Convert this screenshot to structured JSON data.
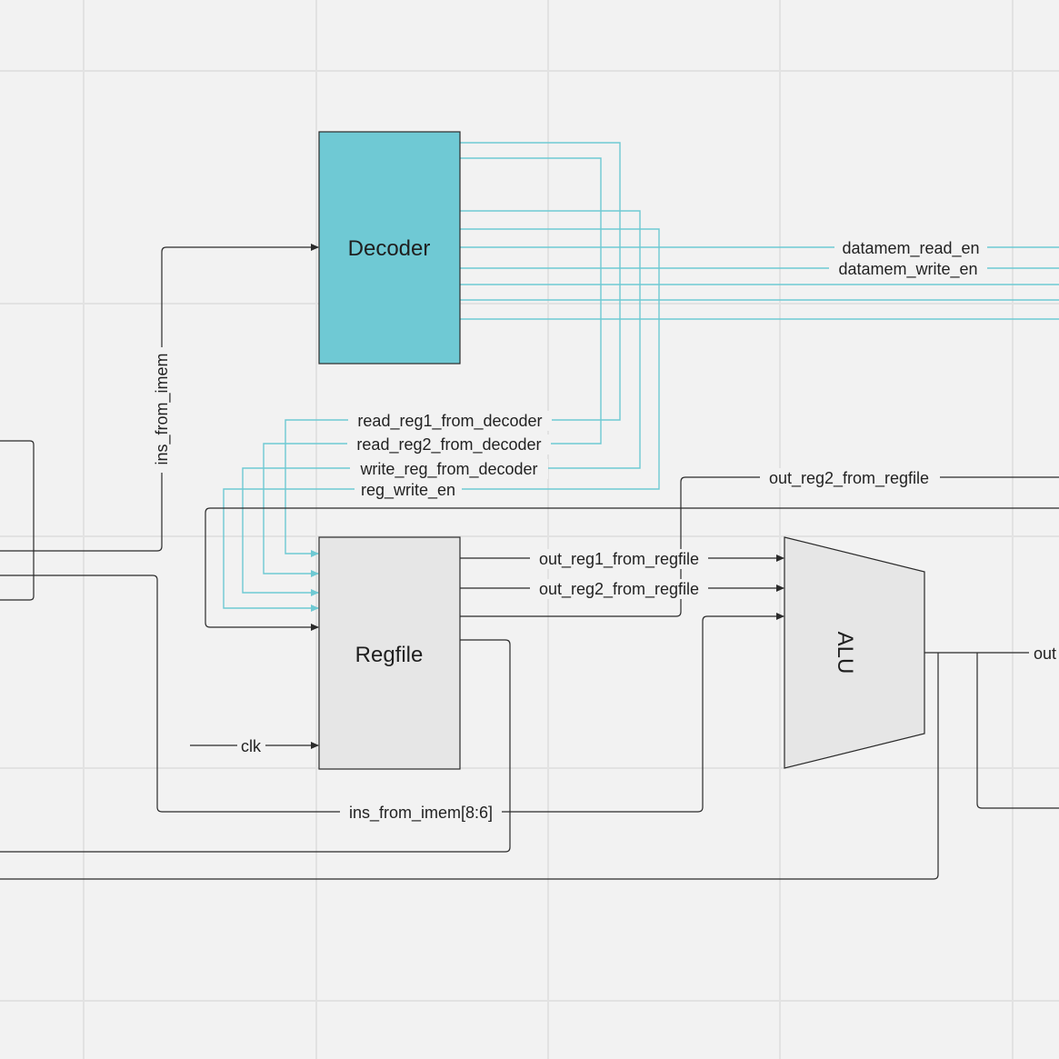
{
  "colors": {
    "background": "#f2f2f2",
    "grid": "#e2e2e2",
    "wire": "#2b2b2b",
    "control_wire": "#6ec9d3",
    "decoder_fill": "#6fc9d4",
    "block_fill": "#e6e6e6"
  },
  "blocks": {
    "decoder": "Decoder",
    "regfile": "Regfile",
    "alu": "ALU"
  },
  "signals": {
    "ins_from_imem": "ins_from_imem",
    "datamem_read_en": "datamem_read_en",
    "datamem_write_en": "datamem_write_en",
    "read_reg1_from_decoder": "read_reg1_from_decoder",
    "read_reg2_from_decoder": "read_reg2_from_decoder",
    "write_reg_from_decoder": "write_reg_from_decoder",
    "reg_write_en": "reg_write_en",
    "out_reg2_from_regfile_top": "out_reg2_from_regfile",
    "out_reg1_from_regfile": "out_reg1_from_regfile",
    "out_reg2_from_regfile": "out_reg2_from_regfile",
    "alu_out_partial": "out",
    "clk": "clk",
    "ins_from_imem_8_6": "ins_from_imem[8:6]"
  }
}
